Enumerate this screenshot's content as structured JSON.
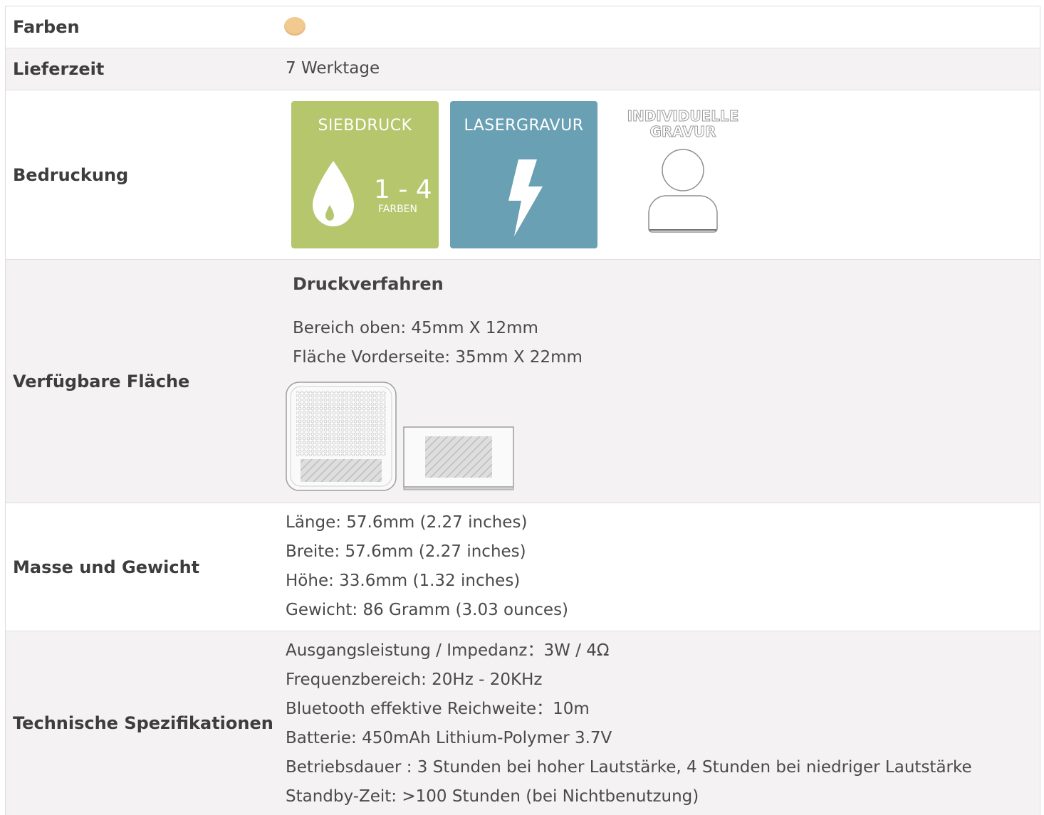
{
  "rows": {
    "farben": {
      "label": "Farben",
      "color": "#f2c98f"
    },
    "lieferzeit": {
      "label": "Lieferzeit",
      "value": "7 Werktage"
    },
    "bedruckung": {
      "label": "Bedruckung",
      "siebdruck": {
        "title": "SIEBDRUCK",
        "number": "1 - 4",
        "sub": "FARBEN",
        "color": "#b5c66c"
      },
      "lasergravur": {
        "title": "LASERGRAVUR",
        "color": "#69a0b3"
      },
      "individuell": {
        "line1": "INDIVIDUELLE",
        "line2": "GRAVUR"
      }
    },
    "flaeche": {
      "label": "Verfügbare Fläche",
      "heading": "Druckverfahren",
      "lines": [
        "Bereich oben: 45mm X 12mm",
        "Fläche Vorderseite: 35mm X 22mm"
      ]
    },
    "masse": {
      "label": "Masse und Gewicht",
      "lines": [
        "Länge: 57.6mm (2.27 inches)",
        "Breite: 57.6mm (2.27 inches)",
        "Höhe: 33.6mm (1.32 inches)",
        "Gewicht: 86 Gramm (3.03 ounces)"
      ]
    },
    "technik": {
      "label": "Technische Spezifikationen",
      "lines": [
        "Ausgangsleistung / Impedanz：3W / 4Ω",
        "Frequenzbereich: 20Hz - 20KHz",
        "Bluetooth effektive Reichweite：10m",
        "Batterie: 450mAh Lithium-Polymer 3.7V",
        "Betriebsdauer : 3 Stunden bei hoher Lautstärke, 4 Stunden bei niedriger Lautstärke",
        "Standby-Zeit: >100 Stunden (bei Nichtbenutzung)"
      ]
    }
  }
}
